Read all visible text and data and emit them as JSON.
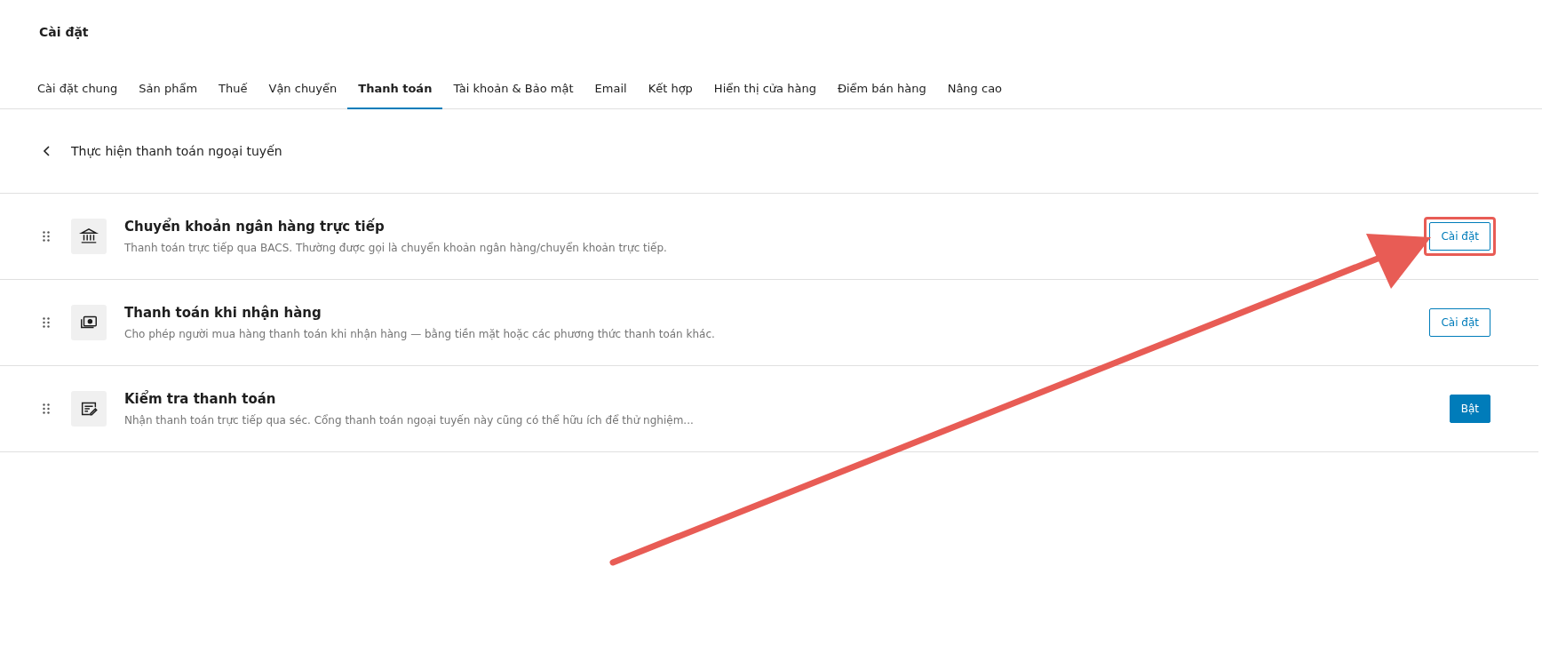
{
  "page_title": "Cài đặt",
  "tabs": [
    {
      "label": "Cài đặt chung",
      "selected": false
    },
    {
      "label": "Sản phẩm",
      "selected": false
    },
    {
      "label": "Thuế",
      "selected": false
    },
    {
      "label": "Vận chuyển",
      "selected": false
    },
    {
      "label": "Thanh toán",
      "selected": true
    },
    {
      "label": "Tài khoản & Bảo mật",
      "selected": false
    },
    {
      "label": "Email",
      "selected": false
    },
    {
      "label": "Kết hợp",
      "selected": false
    },
    {
      "label": "Hiển thị cửa hàng",
      "selected": false
    },
    {
      "label": "Điểm bán hàng",
      "selected": false
    },
    {
      "label": "Nâng cao",
      "selected": false
    }
  ],
  "section_title": "Thực hiện thanh toán ngoại tuyến",
  "methods": [
    {
      "title": "Chuyển khoản ngân hàng trực tiếp",
      "description": "Thanh toán trực tiếp qua BACS. Thường được gọi là chuyển khoản ngân hàng/chuyển khoản trực tiếp.",
      "button": {
        "label": "Cài đặt",
        "kind": "secondary"
      },
      "highlighted": true
    },
    {
      "title": "Thanh toán khi nhận hàng",
      "description": "Cho phép người mua hàng thanh toán khi nhận hàng — bằng tiền mặt hoặc các phương thức thanh toán khác.",
      "button": {
        "label": "Cài đặt",
        "kind": "secondary"
      },
      "highlighted": false
    },
    {
      "title": "Kiểm tra thanh toán",
      "description": "Nhận thanh toán trực tiếp qua séc. Cổng thanh toán ngoại tuyến này cũng có thể hữu ích để thử nghiệm...",
      "button": {
        "label": "Bật",
        "kind": "primary"
      },
      "highlighted": false
    }
  ]
}
